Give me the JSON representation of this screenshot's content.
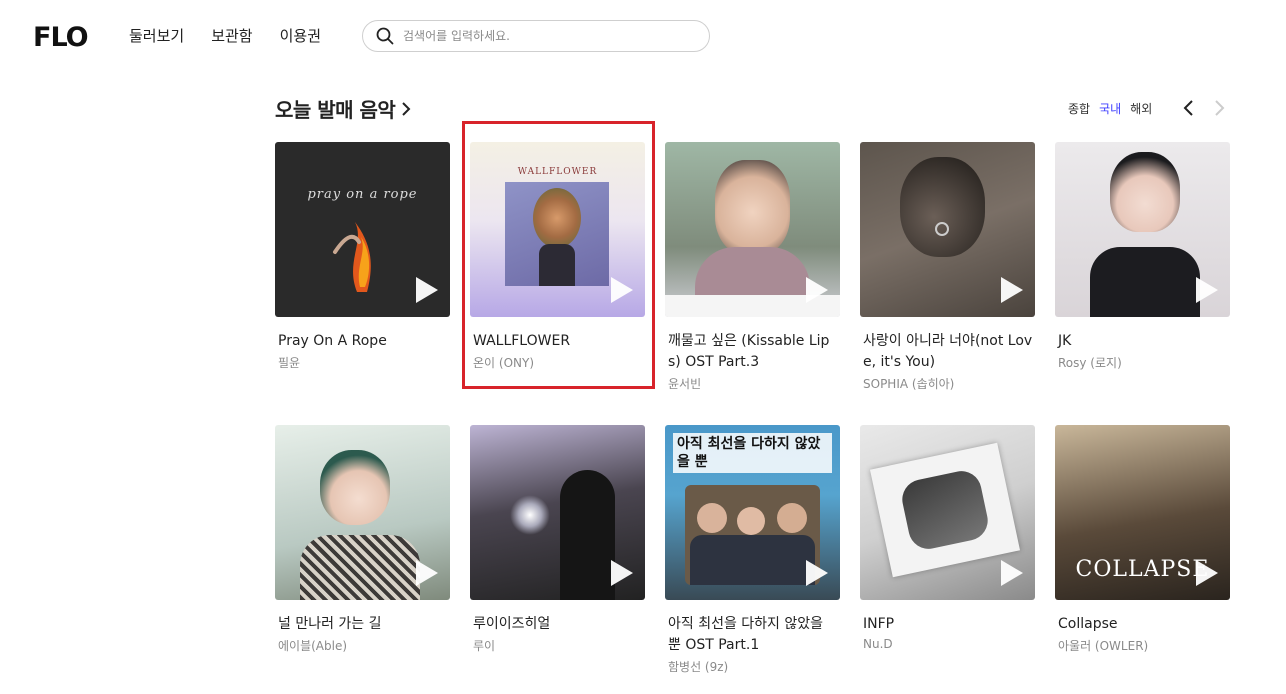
{
  "header": {
    "logo": "FLO",
    "nav": [
      "둘러보기",
      "보관함",
      "이용권"
    ],
    "search_placeholder": "검색어를 입력하세요."
  },
  "section": {
    "title": "오늘 발매 음악",
    "filters": [
      "종합",
      "국내",
      "해외"
    ],
    "active_filter": "국내"
  },
  "albums": [
    {
      "title": "Pray On A Rope",
      "artist": "필윤",
      "art_text": "pray on a rope"
    },
    {
      "title": "WALLFLOWER",
      "artist": "온이 (ONY)",
      "art_text": "WALLFLOWER"
    },
    {
      "title": "깨물고 싶은 (Kissable Lips) OST Part.3",
      "artist": "윤서빈"
    },
    {
      "title": "사랑이 아니라 너야(not Love, it's You)",
      "artist": "SOPHIA (솝히아)"
    },
    {
      "title": "JK",
      "artist": "Rosy (로지)"
    },
    {
      "title": "널 만나러 가는 길",
      "artist": "에이블(Able)"
    },
    {
      "title": "루이이즈히얼",
      "artist": "루이"
    },
    {
      "title": "아직 최선을 다하지 않았을 뿐 OST Part.1",
      "artist": "함병선 (9z)",
      "art_text": "아직 최선을 다하지 않았을 뿐"
    },
    {
      "title": "INFP",
      "artist": "Nu.D"
    },
    {
      "title": "Collapse",
      "artist": "아울러 (OWLER)",
      "art_text": "COLLAPSE"
    }
  ],
  "colors": {
    "accent": "#3f3fff",
    "highlight": "#d8232a"
  }
}
